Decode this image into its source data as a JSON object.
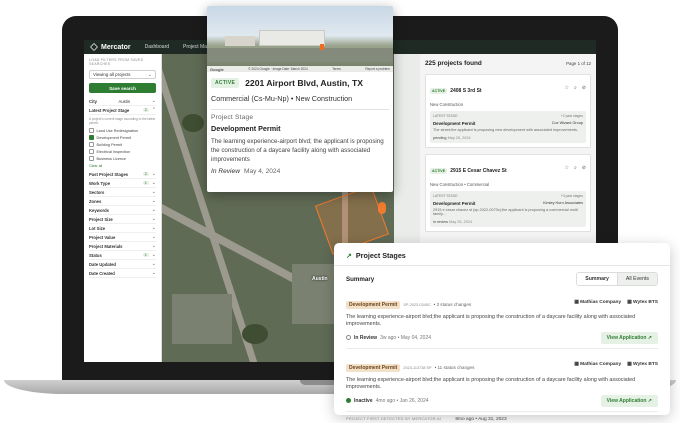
{
  "topbar": {
    "logo": "Mercator",
    "nav": [
      "Dashboard",
      "Project Map"
    ]
  },
  "filters": {
    "caption": "LOAD FILTERS FROM SAVED SEARCHES",
    "saved_select": "Viewing all projects",
    "save_button": "Save search",
    "city_label": "City",
    "city_value": "Austin",
    "latest_stage_label": "Latest Project Stage",
    "latest_stage_count": "2",
    "hint": "A project's current stage according to the latest permit.",
    "stage_options": [
      {
        "label": "Land Use Redesignation",
        "checked": false
      },
      {
        "label": "Development Permit",
        "checked": true
      },
      {
        "label": "Building Permit",
        "checked": false
      },
      {
        "label": "Electrical Inspection",
        "checked": false
      },
      {
        "label": "Business Licence",
        "checked": false
      }
    ],
    "clear_all": "Clear all",
    "groups": [
      {
        "label": "Past Project Stages",
        "count": "2"
      },
      {
        "label": "Work Type",
        "count": "1"
      },
      {
        "label": "Sectors",
        "count": ""
      },
      {
        "label": "Zones",
        "count": ""
      },
      {
        "label": "Keywords",
        "count": ""
      },
      {
        "label": "Project Size",
        "count": ""
      },
      {
        "label": "Lot Size",
        "count": ""
      },
      {
        "label": "Project Value",
        "count": ""
      },
      {
        "label": "Project Materials",
        "count": ""
      },
      {
        "label": "Status",
        "count": "1"
      },
      {
        "label": "Date Updated",
        "count": ""
      },
      {
        "label": "Date Created",
        "count": ""
      }
    ]
  },
  "map": {
    "street_label": "Austin"
  },
  "list": {
    "count": "225 projects found",
    "pager": "Page 1 of 12",
    "cards": [
      {
        "status": "ACTIVE",
        "address": "2408 S 3rd St",
        "type": "New Construction",
        "stage_caption": "LATEST STAGE",
        "past_stages": "+2 past stages",
        "stage": "Development Permit",
        "owner": "Cox Wizard Group",
        "desc": "The street;the applicant is proposing new development with associated improvements.",
        "status_text": "pending",
        "date": "May 25, 2024"
      },
      {
        "status": "ACTIVE",
        "address": "2915 E Cesar Chavez St",
        "type": "New Construction • Commercial",
        "stage_caption": "LATEST STAGE",
        "past_stages": "+3 past stages",
        "stage": "Development Permit",
        "owner": "Kimley Horn Associates",
        "desc": "2915 e cesar chavez st (sp-2022-0073c);the applicant is proposing a commercial multi family…",
        "status_text": "in review",
        "date": "May 25, 2024"
      }
    ]
  },
  "popup": {
    "google": "Google",
    "imagery": "© 2024 Google · Image Date: March 2024",
    "terms": "Terms",
    "report": "Report a problem",
    "status": "ACTIVE",
    "address": "2201 Airport Blvd, Austin, TX",
    "subtitle": "Commercial (Cs-Mu-Np) • New Construction",
    "stage_caption": "Project Stage",
    "stage": "Development Permit",
    "desc": "The learning experience-airport blvd; the applicant is proposing the construction of a daycare facility along with associated improvements",
    "status_text": "In Review",
    "date": "May 4, 2024"
  },
  "stages_card": {
    "title": "Project Stages",
    "summary": "Summary",
    "tab_summary": "Summary",
    "tab_all": "All Events",
    "items": [
      {
        "tag": "Development Permit",
        "code": "SP-2023-0345C",
        "changes": "• 3 status changes",
        "company1": "Mathias Company",
        "company2": "Wytex BTS",
        "desc": "The learning experience-airport blvd;the applicant is proposing the construction of a daycare facility along with associated improvements.",
        "status": "In Review",
        "when": "3w ago • May 04, 2024",
        "button": "View Application"
      },
      {
        "tag": "Development Permit",
        "code": "2023-113738 SP",
        "changes": "• 11 status changes",
        "company1": "Mathias Company",
        "company2": "Wytex BTS",
        "desc": "The learning experience-airport blvd;the applicant is proposing the construction of a daycare facility along with associated improvements.",
        "status": "Inactive",
        "when": "4mo ago • Jan 26, 2024",
        "button": "View Application"
      }
    ],
    "first_detected_caption": "PROJECT FIRST DETECTED BY MERCATOR.AI",
    "first_detected_value": "8mo ago • Aug 31, 2023"
  },
  "colors": {
    "accent": "#2e7d32",
    "parcel": "#f07b2e",
    "topbar": "#1f2a24"
  }
}
